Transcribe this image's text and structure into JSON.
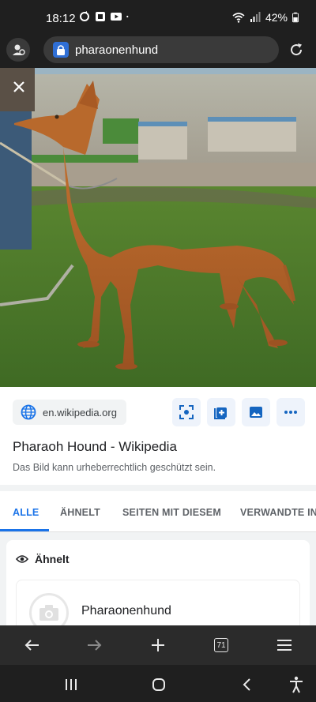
{
  "status_bar": {
    "time": "18:12",
    "battery": "42%"
  },
  "url_bar": {
    "query": "pharaonenhund"
  },
  "result": {
    "source": "en.wikipedia.org",
    "title": "Pharaoh Hound - Wikipedia",
    "copyright_note": "Das Bild kann urheberrechtlich geschützt sein."
  },
  "tabs": [
    {
      "label": "ALLE",
      "active": true
    },
    {
      "label": "ÄHNELT",
      "active": false
    },
    {
      "label": "SEITEN MIT DIESEM",
      "active": false
    },
    {
      "label": "VERWANDTE INH",
      "active": false
    }
  ],
  "similar_section": {
    "heading": "Ähnelt",
    "items": [
      {
        "label": "Pharaonenhund"
      }
    ]
  },
  "bottom_nav": {
    "tab_count": "71"
  },
  "colors": {
    "accent": "#1a73e8",
    "chrome_bg": "#1f1f1f",
    "dog": "#b5652a",
    "grass": "#4f7a2c"
  },
  "icons": [
    "profile-icon",
    "lock-icon",
    "reload-icon",
    "close-icon",
    "globe-icon",
    "lens-icon",
    "add-to-collection-icon",
    "image-icon",
    "more-icon",
    "eye-icon",
    "camera-icon",
    "back-arrow-icon",
    "forward-arrow-icon",
    "plus-icon",
    "tabs-icon",
    "menu-icon"
  ]
}
